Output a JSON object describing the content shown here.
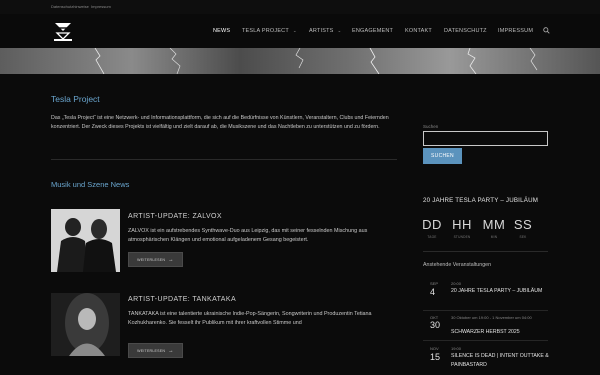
{
  "topbar": {
    "privacy": "Datenschutzhinweise",
    "imprint": "Impressum"
  },
  "nav": [
    {
      "label": "NEWS",
      "dropdown": false
    },
    {
      "label": "TESLA PROJECT",
      "dropdown": true
    },
    {
      "label": "ARTISTS",
      "dropdown": true
    },
    {
      "label": "ENGAGEMENT",
      "dropdown": false
    },
    {
      "label": "KONTAKT",
      "dropdown": false
    },
    {
      "label": "DATENSCHUTZ",
      "dropdown": false
    },
    {
      "label": "IMPRESSUM",
      "dropdown": false
    }
  ],
  "main": {
    "title": "Tesla Project",
    "intro": "Das „Tesla Project“ ist eine Netzwerk- und Informationsplattform, die sich auf die Bedürfnisse von Künstlern, Veranstaltern, Clubs und Feiernden konzentriert. Der Zweck dieses Projekts ist vielfältig und zielt darauf ab, die Musikszene und das Nachtleben zu unterstützen und zu fördern.",
    "section_title": "Musik und Szene News",
    "posts": [
      {
        "title": "ARTIST-UPDATE: ZALVOX",
        "text": "ZALVOX ist ein aufstrebendes Synthwave-Duo aus Leipzig, das mit seiner fesselnden Mischung aus atmosphärischen Klängen und emotional aufgeladenem Gesang begeistert.",
        "button": "WEITERLESEN"
      },
      {
        "title": "ARTIST-UPDATE: TANKATAKA",
        "text": "TANKATAKA ist eine talentierte ukrainische Indie-Pop-Sängerin, Songwriterin und Produzentin Tetiana Kozhukharenko. Sie fesselt ihr Publikum mit ihrer kraftvollen Stimme und",
        "button": "WEITERLESEN"
      }
    ]
  },
  "sidebar": {
    "search_label": "Suchen",
    "search_value": "",
    "search_button": "SUCHEN",
    "countdown_title": "20 JAHRE TESLA PARTY – JUBILÄUM",
    "countdown": [
      {
        "value": "DD",
        "label": "TAGE"
      },
      {
        "value": "HH",
        "label": "STUNDEN"
      },
      {
        "value": "MM",
        "label": "MIN"
      },
      {
        "value": "SS",
        "label": "SEK"
      }
    ],
    "upcoming_title": "Anstehende Veranstaltungen",
    "events": [
      {
        "month": "SEP",
        "day": "4",
        "time": "20:00",
        "title": "20 JAHRE TESLA PARTY – JUBILÄUM"
      },
      {
        "month": "OKT",
        "day": "30",
        "time": "30 Oktober um 19:00 - 1 November um 04:00",
        "title": "SCHWARZER HERBST 2025"
      },
      {
        "month": "NOV",
        "day": "15",
        "time": "19:00",
        "title": "SILENCE IS DEAD | INTENT OUTTAKE & PAINBASTARD"
      }
    ]
  },
  "colors": {
    "accent": "#6aa6cf",
    "button": "#5b93bd",
    "background": "#0b0b0b"
  }
}
